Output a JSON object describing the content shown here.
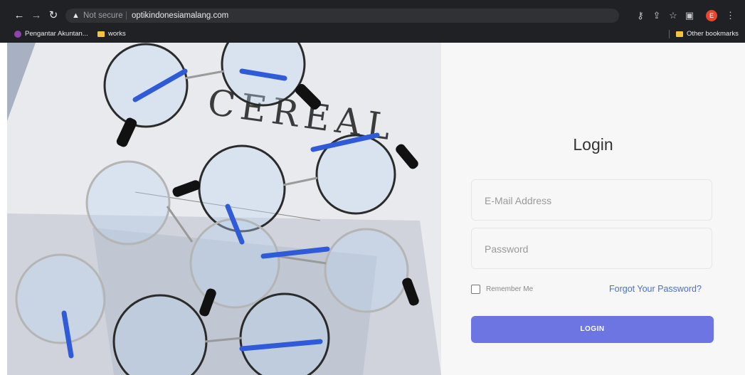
{
  "browser": {
    "address": {
      "warning": "Not secure",
      "url": "optikindonesiamalang.com"
    },
    "icons": {
      "back": "back-arrow-icon",
      "forward": "forward-arrow-icon",
      "reload": "reload-icon",
      "warning": "warning-triangle-icon",
      "key": "key-icon",
      "share": "share-icon",
      "star": "star-icon",
      "sidepanel": "side-panel-icon",
      "menu": "kebab-menu-icon"
    },
    "avatar_letter": "E",
    "bookmarks": [
      {
        "label": "Pengantar Akuntan..."
      },
      {
        "label": "works"
      }
    ],
    "other_bookmarks": "Other bookmarks"
  },
  "login": {
    "title": "Login",
    "email_placeholder": "E-Mail Address",
    "password_placeholder": "Password",
    "remember_label": "Remember Me",
    "forgot_label": "Forgot Your Password?",
    "button_label": "LOGIN"
  },
  "hero": {
    "caption": "CEREAL"
  },
  "colors": {
    "accent": "#6d75e3",
    "link": "#4a6fd1",
    "chrome_bg": "#202124"
  }
}
